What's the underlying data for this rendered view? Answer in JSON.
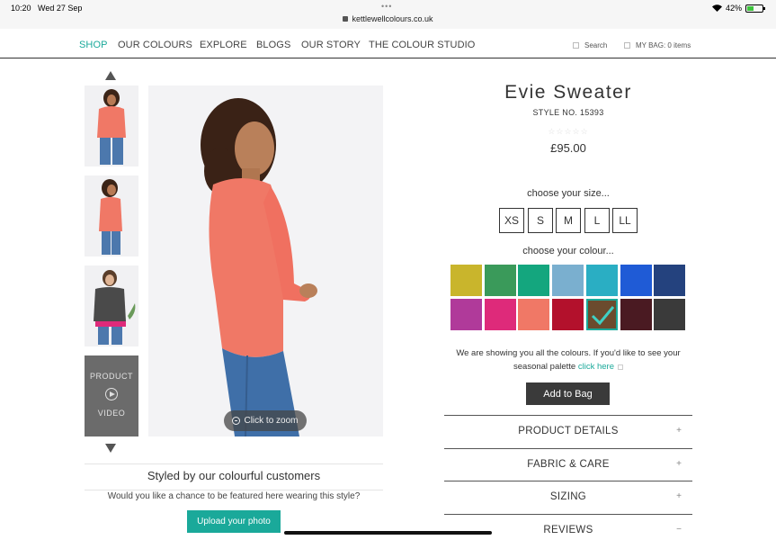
{
  "status_bar": {
    "time": "10:20",
    "date": "Wed 27 Sep",
    "dots": "•••",
    "url": "kettlewellcolours.co.uk",
    "battery": "42%"
  },
  "nav": {
    "items": [
      {
        "label": "SHOP",
        "active": true
      },
      {
        "label": "OUR COLOURS"
      },
      {
        "label": "EXPLORE"
      },
      {
        "label": "BLOGS"
      },
      {
        "label": "OUR STORY"
      },
      {
        "label": "THE COLOUR STUDIO"
      }
    ],
    "search_label": "Search",
    "bag_label": "MY BAG: 0 items"
  },
  "gallery": {
    "video_label_top": "PRODUCT",
    "video_label_bottom": "VIDEO",
    "zoom_label": "Click to zoom"
  },
  "product": {
    "title": "Evie Sweater",
    "style_no": "STYLE NO. 15393",
    "stars": "☆☆☆☆☆",
    "price": "£95.00",
    "size_label": "choose your size...",
    "sizes": [
      "XS",
      "S",
      "M",
      "L",
      "LL"
    ],
    "colour_label": "choose your colour...",
    "colours": [
      "#c9b52c",
      "#3a9a5a",
      "#14a67e",
      "#7aafcf",
      "#2aaec3",
      "#1f5bd6",
      "#24427e",
      "#b03a9a",
      "#de2a7a",
      "#f07866",
      "#b3112c",
      "#6b4b2e",
      "#4a1a22",
      "#3a3a3a"
    ],
    "selected_colour_index": 11,
    "note_text": "We are showing you all the colours. If you'd like to see your seasonal palette",
    "note_link": "click here",
    "add_to_bag": "Add to Bag",
    "accordion": [
      {
        "label": "PRODUCT DETAILS",
        "icon": "+"
      },
      {
        "label": "FABRIC & CARE",
        "icon": "+"
      },
      {
        "label": "SIZING",
        "icon": "+"
      },
      {
        "label": "REVIEWS",
        "icon": "−"
      }
    ]
  },
  "customers": {
    "title": "Styled by our colourful customers",
    "subtitle": "Would you like a chance to be featured here wearing this style?",
    "upload_label": "Upload your photo"
  }
}
